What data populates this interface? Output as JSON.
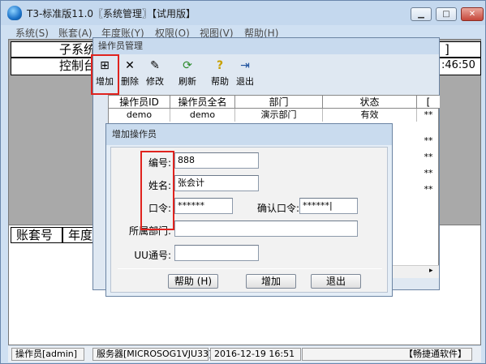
{
  "app": {
    "title": "T3-标准版11.0〖系统管理〗【试用版】"
  },
  "menu": [
    "系统(S)",
    "账套(A)",
    "年度账(Y)",
    "权限(O)",
    "视图(V)",
    "帮助(H)"
  ],
  "background": {
    "header_subsystem": "子系统",
    "header_console": "控制台",
    "time_fragment": "]",
    "time_fragment2": ":46:50",
    "col_account": "账套号",
    "col_year": "年度"
  },
  "operator_window": {
    "title": "操作员管理",
    "toolbar": [
      {
        "label": "增加",
        "icon": "add-icon"
      },
      {
        "label": "删除",
        "icon": "delete-icon"
      },
      {
        "label": "修改",
        "icon": "edit-icon"
      },
      {
        "label": "刷新",
        "icon": "refresh-icon"
      },
      {
        "label": "帮助",
        "icon": "help-icon"
      },
      {
        "label": "退出",
        "icon": "exit-icon"
      }
    ],
    "grid": {
      "columns": [
        "操作员ID",
        "操作员全名",
        "部门",
        "状态",
        "["
      ],
      "rows": [
        [
          "demo",
          "demo",
          "演示部门",
          "有效",
          "**"
        ]
      ],
      "extra_cells": [
        "**",
        "**",
        "**",
        "**"
      ]
    }
  },
  "add_dialog": {
    "title": "增加操作员",
    "labels": {
      "code": "编号:",
      "name": "姓名:",
      "password": "口令:",
      "confirm": "确认口令:",
      "dept": "所属部门:",
      "uu": "UU通号:"
    },
    "values": {
      "code": "888",
      "name": "张会计",
      "password": "******",
      "confirm": "******|",
      "dept": "",
      "uu": ""
    },
    "buttons": {
      "help": "帮助 (H)",
      "add": "增加",
      "exit": "退出"
    }
  },
  "status": {
    "operator": "操作员[admin]",
    "server": "服务器[MICROSOG1VJU33]",
    "datetime": "2016-12-19 16:51",
    "brand": "【畅捷通软件】"
  }
}
